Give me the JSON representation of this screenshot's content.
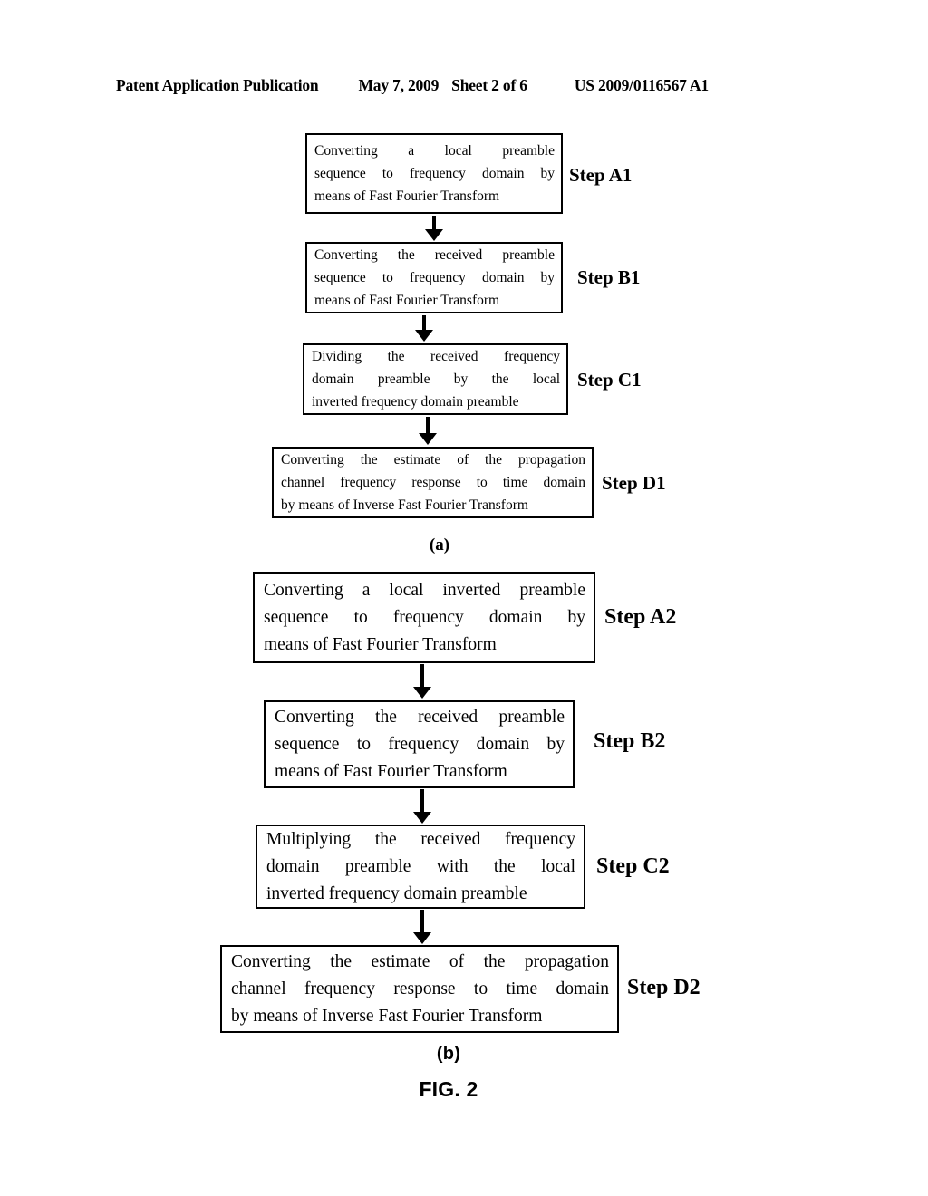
{
  "header": {
    "publication": "Patent Application Publication",
    "date": "May 7, 2009",
    "sheet": "Sheet 2 of 6",
    "document_number": "US 2009/0116567 A1"
  },
  "figure": {
    "caption": "FIG. 2",
    "subfigures": [
      {
        "label": "(a)",
        "steps": [
          {
            "step_label": "Step A1",
            "lines": [
              "Converting a local preamble",
              "sequence to frequency domain by",
              "means of Fast Fourier Transform"
            ]
          },
          {
            "step_label": "Step B1",
            "lines": [
              "Converting the received preamble",
              "sequence to frequency domain by",
              "means of Fast Fourier Transform"
            ]
          },
          {
            "step_label": "Step C1",
            "lines": [
              "Dividing the received frequency",
              "domain preamble by the local",
              "inverted frequency domain preamble"
            ]
          },
          {
            "step_label": "Step D1",
            "lines": [
              "Converting the estimate of the propagation",
              "channel frequency response to time domain",
              "by means of Inverse Fast Fourier Transform"
            ]
          }
        ]
      },
      {
        "label": "(b)",
        "steps": [
          {
            "step_label": "Step A2",
            "lines": [
              "Converting a local inverted preamble",
              "sequence to frequency domain by",
              "means of Fast Fourier Transform"
            ]
          },
          {
            "step_label": "Step B2",
            "lines": [
              "Converting the received preamble",
              "sequence to frequency domain by",
              "means of Fast Fourier Transform"
            ]
          },
          {
            "step_label": "Step C2",
            "lines": [
              "Multiplying the received frequency",
              "domain preamble with the local",
              "inverted frequency domain preamble"
            ]
          },
          {
            "step_label": "Step D2",
            "lines": [
              "Converting the estimate of the propagation",
              "channel frequency response to time domain",
              "by means of Inverse Fast Fourier Transform"
            ]
          }
        ]
      }
    ]
  }
}
